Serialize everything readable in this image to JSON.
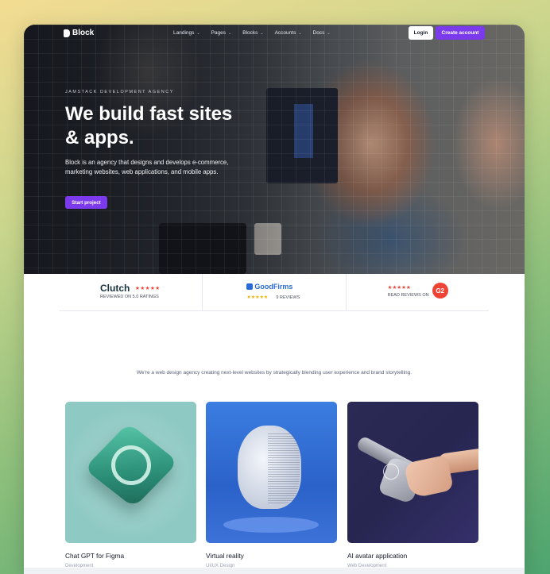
{
  "nav": {
    "logo": "Block",
    "items": [
      {
        "label": "Landings"
      },
      {
        "label": "Pages"
      },
      {
        "label": "Blocks"
      },
      {
        "label": "Accounts"
      },
      {
        "label": "Docs"
      }
    ],
    "login_label": "Login",
    "create_account_label": "Create account"
  },
  "hero": {
    "eyebrow": "JAMSTACK DEVELOPMENT AGENCY",
    "headline": "We build fast sites & apps.",
    "subtitle": "Block is an agency that designs and develops e-commerce, marketing websites, web applications, and mobile apps.",
    "cta_label": "Start project"
  },
  "reviews": {
    "clutch": {
      "name": "Clutch",
      "stars": "★★★★★",
      "caption": "REVIEWED ON 5.0 RATINGS"
    },
    "goodfirms": {
      "name": "GoodFirms",
      "stars": "★★★★★",
      "caption": "9 REVIEWS"
    },
    "g2": {
      "stars": "★★★★★",
      "caption": "READ REVIEWS ON",
      "logo": "G2"
    }
  },
  "intro": {
    "text": "We're a web design agency creating next-level websites by strategically blending user experience and brand storytelling."
  },
  "projects": [
    {
      "title": "Chat GPT for Figma",
      "tag": "Development"
    },
    {
      "title": "Virtual reality",
      "tag": "UI/UX Design"
    },
    {
      "title": "AI avatar application",
      "tag": "Web Development"
    }
  ],
  "colors": {
    "accent": "#7c3aed",
    "clutch_star": "#ef4335",
    "goodfirms_blue": "#2a6ad6",
    "goodfirms_star": "#f0b400"
  }
}
